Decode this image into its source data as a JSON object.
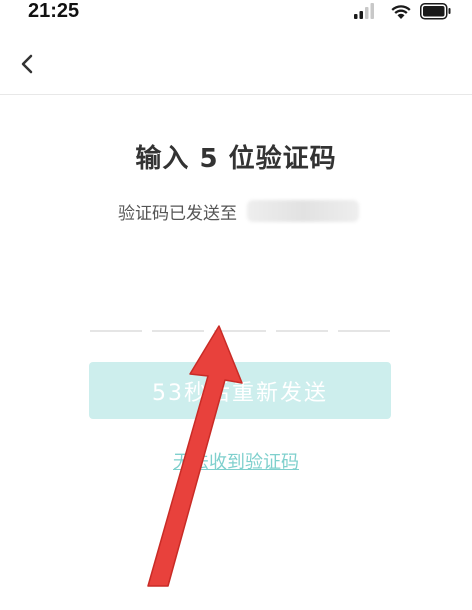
{
  "status_bar": {
    "time": "21:25"
  },
  "nav": {
    "back_icon": "chevron-left-icon"
  },
  "main": {
    "title": "输入 5 位验证码",
    "sent_label": "验证码已发送至",
    "code_length": 5,
    "resend_label": "53秒后重新发送",
    "no_code_link": "无法收到验证码"
  },
  "colors": {
    "accent": "#7fd0cd",
    "button_disabled": "#cdeeed",
    "annotation_arrow": "#e8413c"
  }
}
